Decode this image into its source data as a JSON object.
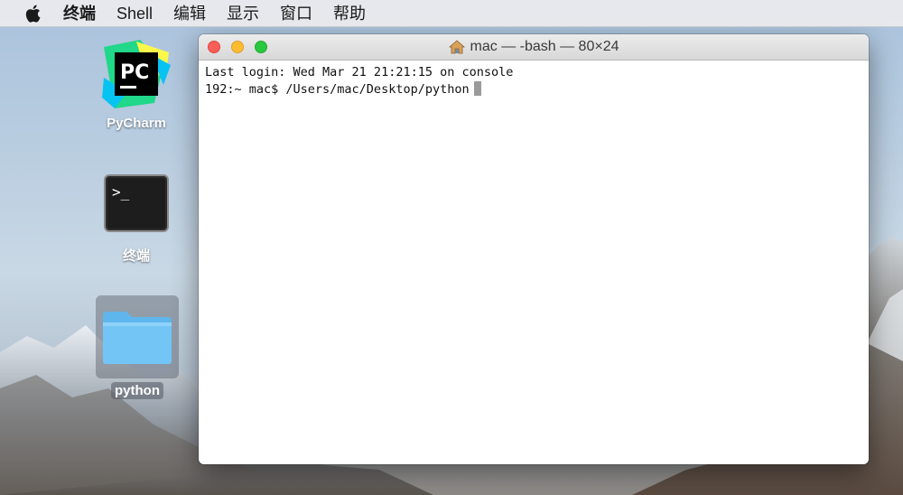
{
  "menubar": {
    "apple_icon": "apple-logo-icon",
    "items": [
      "终端",
      "Shell",
      "编辑",
      "显示",
      "窗口",
      "帮助"
    ]
  },
  "desktop_icons": {
    "pycharm": {
      "label": "PyCharm",
      "icon": "pycharm-app-icon",
      "icon_text": "PC"
    },
    "terminal": {
      "label": "终端",
      "icon": "terminal-app-icon",
      "icon_text": ">_"
    },
    "python": {
      "label": "python",
      "icon": "folder-icon",
      "selected": true
    }
  },
  "terminal": {
    "title": "mac — -bash — 80×24",
    "title_icon": "home-icon",
    "lines": [
      "Last login: Wed Mar 21 21:21:15 on console",
      "192:~ mac$ /Users/mac/Desktop/python"
    ]
  },
  "colors": {
    "close": "#fc5f57",
    "minimize": "#fdbc2e",
    "zoom": "#28c840"
  }
}
